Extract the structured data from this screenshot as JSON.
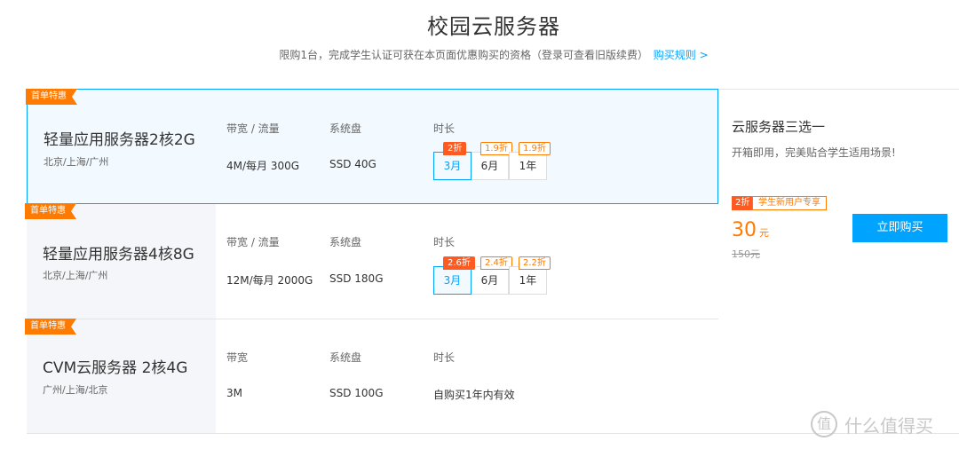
{
  "header": {
    "title": "校园云服务器",
    "subtitle": "限购1台，完成学生认证可获在本页面优惠购买的资格（登录可查看旧版续费）",
    "rules_link": "购买规则 >"
  },
  "cards": [
    {
      "ribbon": "首单特惠",
      "name": "轻量应用服务器2核2G",
      "region": "北京/上海/广州",
      "col1_head": "带宽 / 流量",
      "col1_val": "4M/每月 300G",
      "col2_head": "系统盘",
      "col2_val": "SSD 40G",
      "col3_head": "时长",
      "durations": [
        {
          "label": "3月",
          "discount": "2折",
          "selected": true
        },
        {
          "label": "6月",
          "discount": "1.9折",
          "selected": false
        },
        {
          "label": "1年",
          "discount": "1.9折",
          "selected": false
        }
      ]
    },
    {
      "ribbon": "首单特惠",
      "name": "轻量应用服务器4核8G",
      "region": "北京/上海/广州",
      "col1_head": "带宽 / 流量",
      "col1_val": "12M/每月 2000G",
      "col2_head": "系统盘",
      "col2_val": "SSD 180G",
      "col3_head": "时长",
      "durations": [
        {
          "label": "3月",
          "discount": "2.6折",
          "selected": true
        },
        {
          "label": "6月",
          "discount": "2.4折",
          "selected": false
        },
        {
          "label": "1年",
          "discount": "2.2折",
          "selected": false
        }
      ]
    },
    {
      "ribbon": "首单特惠",
      "name": "CVM云服务器 2核4G",
      "region": "广州/上海/北京",
      "col1_head": "带宽",
      "col1_val": "3M",
      "col2_head": "系统盘",
      "col2_val": "SSD 100G",
      "col3_head": "时长",
      "col3_val": "自购买1年内有效"
    }
  ],
  "side": {
    "title": "云服务器三选一",
    "desc": "开箱即用，完美贴合学生适用场景!",
    "discount": "2折",
    "promo": "学生新用户专享",
    "price": "30",
    "price_unit": "元",
    "original": "150元",
    "buy": "立即购买"
  },
  "watermark": {
    "logo": "值",
    "text": "什么值得买"
  },
  "colors": {
    "accent": "#00a4ff",
    "orange": "#ff7a00",
    "discount_fill": "#ff5a1f"
  }
}
